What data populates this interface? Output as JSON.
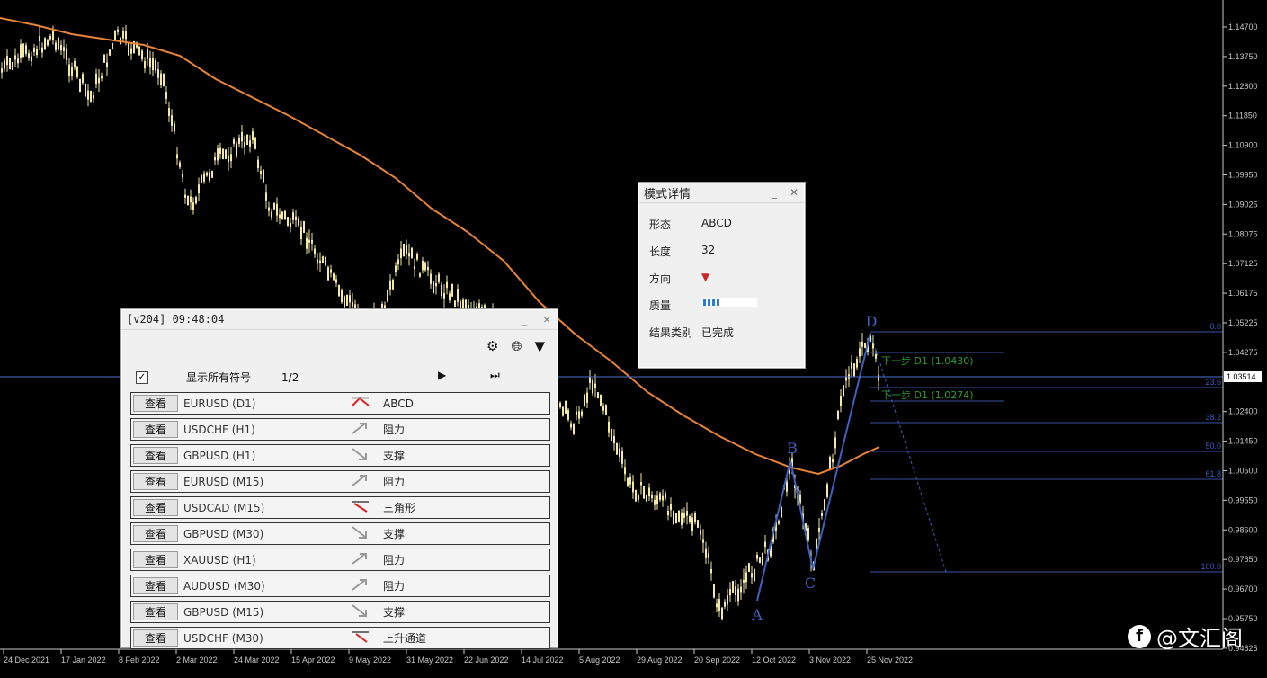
{
  "price_axis": {
    "labels": [
      "1.14700",
      "1.13750",
      "1.12800",
      "1.11850",
      "1.10900",
      "1.09950",
      "1.09025",
      "1.08075",
      "1.07125",
      "1.06175",
      "1.05225",
      "1.04275",
      "1.03351",
      "1.02400",
      "1.01450",
      "1.00500",
      "0.99550",
      "0.98600",
      "0.97650",
      "0.96700",
      "0.95750",
      "0.94825"
    ],
    "current": "1.03514"
  },
  "date_axis": [
    "24 Dec 2021",
    "17 Jan 2022",
    "8 Feb 2022",
    "2 Mar 2022",
    "24 Mar 2022",
    "15 Apr 2022",
    "9 May 2022",
    "31 May 2022",
    "22 Jun 2022",
    "14 Jul 2022",
    "5 Aug 2022",
    "29 Aug 2022",
    "20 Sep 2022",
    "12 Oct 2022",
    "3 Nov 2022",
    "25 Nov 2022"
  ],
  "pattern_points": {
    "a": "A",
    "b": "B",
    "c": "C",
    "d": "D"
  },
  "fib_levels": [
    "0.0",
    "23.6",
    "38.2",
    "50.0",
    "61.8",
    "100.0"
  ],
  "targets": [
    "下一步 D1 (1.0430)",
    "下一步 D1 (1.0274)"
  ],
  "colors": {
    "candle": "#f3eaa2",
    "ma": "#e8843a",
    "pattern": "#4060c0",
    "fib": "#3a4fa0",
    "target": "#2f9a2f"
  },
  "list_panel": {
    "title": "[v204] 09:48:04",
    "minimize": "_",
    "close": "✕",
    "tool_icons": [
      "gear-icon",
      "globe-icon",
      "filter-icon"
    ],
    "show_all_label": "显示所有符号",
    "show_all_checked": true,
    "page": "1/2",
    "rows": [
      {
        "btn": "查看",
        "symbol": "EURUSD (D1)",
        "icon": "abcd",
        "pattern": "ABCD"
      },
      {
        "btn": "查看",
        "symbol": "USDCHF (H1)",
        "icon": "resistance",
        "pattern": "阻力"
      },
      {
        "btn": "查看",
        "symbol": "GBPUSD (H1)",
        "icon": "support",
        "pattern": "支撑"
      },
      {
        "btn": "查看",
        "symbol": "EURUSD (M15)",
        "icon": "resistance",
        "pattern": "阻力"
      },
      {
        "btn": "查看",
        "symbol": "USDCAD (M15)",
        "icon": "triangle",
        "pattern": "三角形"
      },
      {
        "btn": "查看",
        "symbol": "GBPUSD (M30)",
        "icon": "support",
        "pattern": "支撑"
      },
      {
        "btn": "查看",
        "symbol": "XAUUSD (H1)",
        "icon": "resistance",
        "pattern": "阻力"
      },
      {
        "btn": "查看",
        "symbol": "AUDUSD (M30)",
        "icon": "resistance",
        "pattern": "阻力"
      },
      {
        "btn": "查看",
        "symbol": "GBPUSD (M15)",
        "icon": "support",
        "pattern": "支撑"
      },
      {
        "btn": "查看",
        "symbol": "USDCHF (M30)",
        "icon": "channel",
        "pattern": "上升通道"
      }
    ]
  },
  "detail_panel": {
    "title": "模式详情",
    "minimize": "_",
    "close": "✕",
    "rows": [
      {
        "k": "形态",
        "v": "ABCD"
      },
      {
        "k": "长度",
        "v": "32"
      },
      {
        "k": "方向",
        "v": "▼"
      },
      {
        "k": "质量",
        "v": ""
      },
      {
        "k": "结果类别",
        "v": "已完成"
      }
    ],
    "quality_segments": 4
  },
  "watermark": "@文汇阁"
}
